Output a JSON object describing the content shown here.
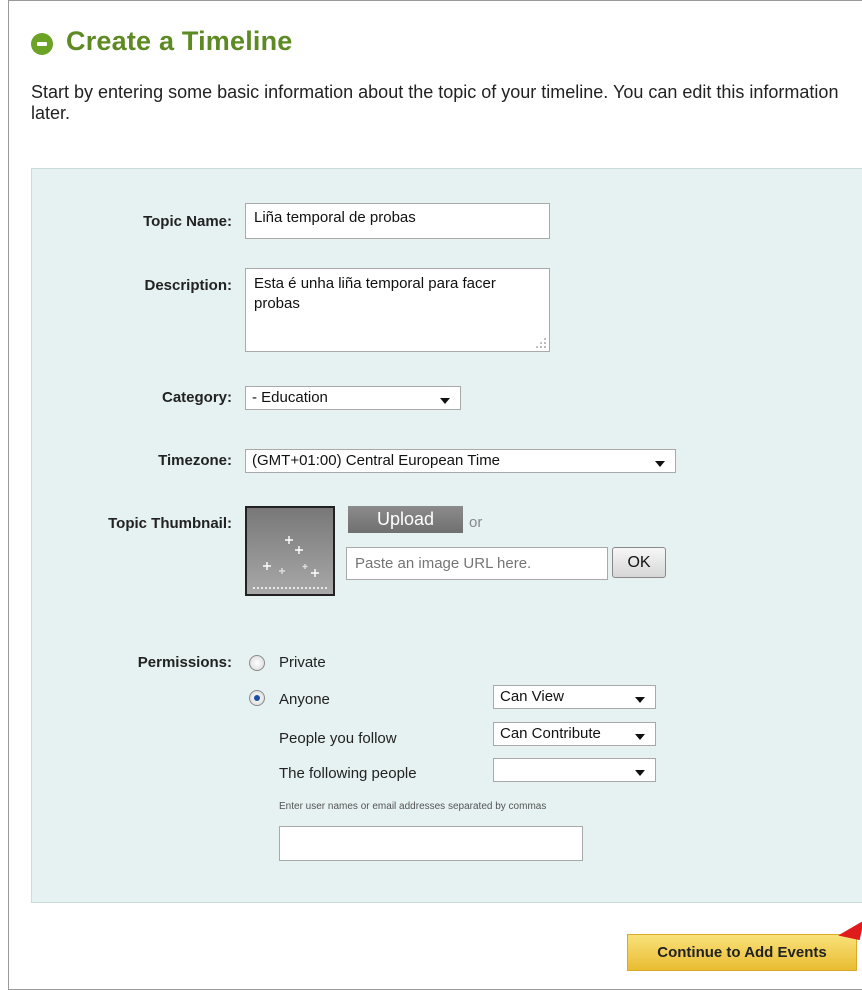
{
  "header": {
    "title": "Create a Timeline",
    "intro": "Start by entering some basic information about the topic of your timeline. You can edit this information later."
  },
  "form": {
    "topic_name_label": "Topic Name:",
    "topic_name_value": "Liña temporal de probas",
    "description_label": "Description:",
    "description_value": "Esta é unha liña temporal para facer probas",
    "category_label": "Category:",
    "category_value": "- Education",
    "timezone_label": "Timezone:",
    "timezone_value": "(GMT+01:00) Central European Time",
    "thumbnail_label": "Topic Thumbnail:",
    "upload_label": "Upload",
    "or_label": "or",
    "image_url_placeholder": "Paste an image URL here.",
    "ok_label": "OK",
    "permissions_label": "Permissions:",
    "private_label": "Private",
    "anyone_label": "Anyone",
    "anyone_permission": "Can View",
    "people_follow_label": "People you follow",
    "people_follow_permission": "Can Contribute",
    "following_people_label": "The following people",
    "following_people_permission": "",
    "hint": "Enter user names or email addresses separated by commas",
    "people_input_value": ""
  },
  "actions": {
    "continue_label": "Continue to Add Events"
  },
  "colors": {
    "title": "#5d8a22",
    "panel": "#e6f1f1",
    "continue_button": "#f0cf55"
  },
  "icons": {
    "title_icon": "minus-circle-icon",
    "thumbnail_icon": "sparkle-placeholder-icon"
  }
}
